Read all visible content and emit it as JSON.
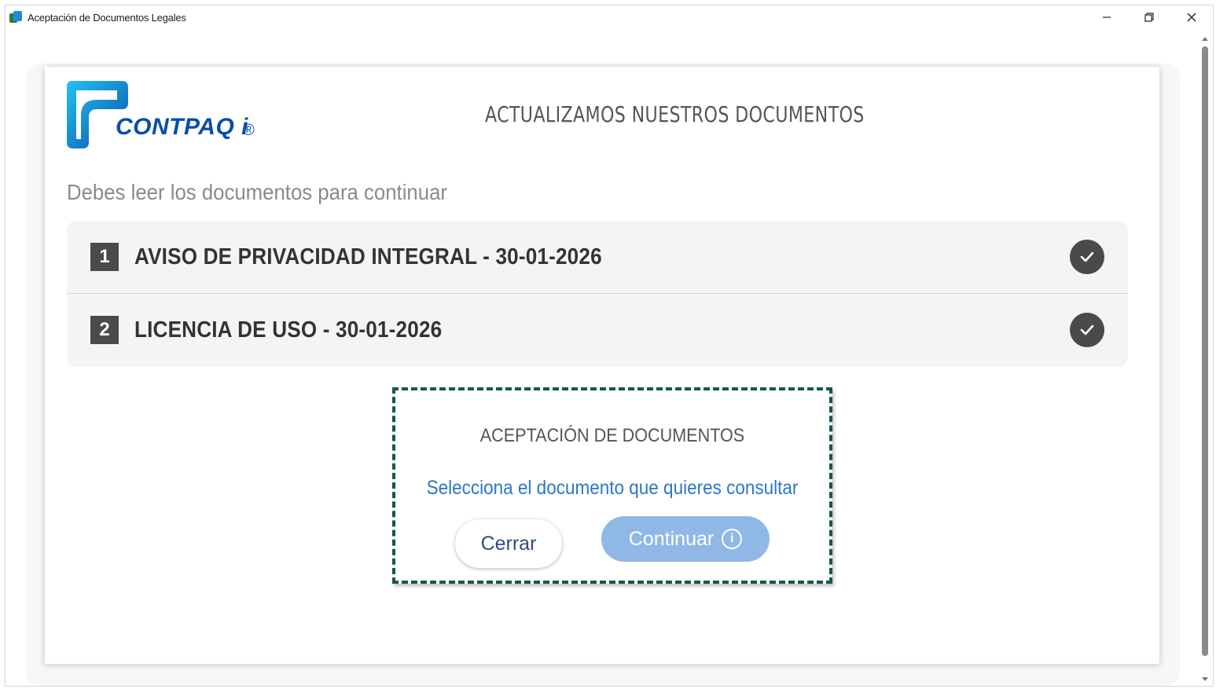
{
  "window": {
    "title": "Aceptación de Documentos Legales",
    "controls": {
      "minimize_icon": "minimize-icon",
      "restore_icon": "restore-icon",
      "close_icon": "close-icon"
    }
  },
  "logo": {
    "brand": "CONTPAQ i",
    "registered": "®"
  },
  "header": {
    "title": "ACTUALIZAMOS NUESTROS DOCUMENTOS"
  },
  "subtitle": "Debes leer los documentos para continuar",
  "documents": [
    {
      "number": "1",
      "label": "AVISO DE PRIVACIDAD INTEGRAL - 30-01-2026",
      "status": "read"
    },
    {
      "number": "2",
      "label": "LICENCIA DE USO - 30-01-2026",
      "status": "read"
    }
  ],
  "acceptance": {
    "title": "ACEPTACIÓN DE DOCUMENTOS",
    "link": "Selecciona el documento que quieres consultar",
    "close_label": "Cerrar",
    "continue_label": "Continuar",
    "info_glyph": "i"
  },
  "colors": {
    "accent_blue": "#2a78c8",
    "continue_disabled": "#8fb8e6",
    "dashed_border": "#17564f",
    "check_bg": "#4a4a4a"
  }
}
